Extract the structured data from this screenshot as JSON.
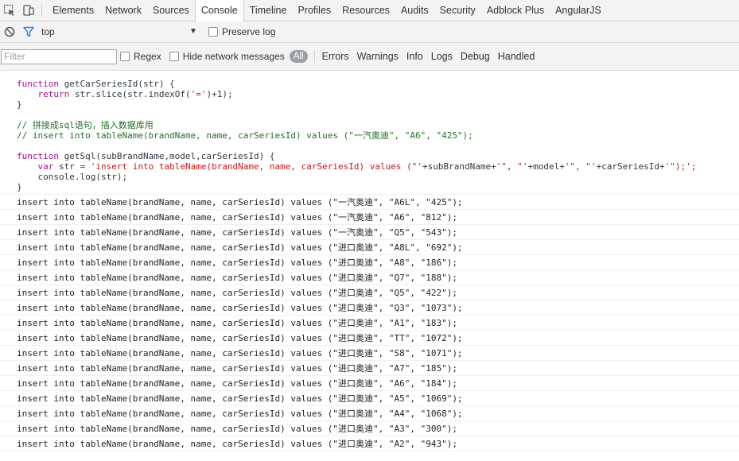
{
  "tabs": [
    {
      "label": "Elements",
      "active": false
    },
    {
      "label": "Network",
      "active": false
    },
    {
      "label": "Sources",
      "active": false
    },
    {
      "label": "Console",
      "active": true
    },
    {
      "label": "Timeline",
      "active": false
    },
    {
      "label": "Profiles",
      "active": false
    },
    {
      "label": "Resources",
      "active": false
    },
    {
      "label": "Audits",
      "active": false
    },
    {
      "label": "Security",
      "active": false
    },
    {
      "label": "Adblock Plus",
      "active": false
    },
    {
      "label": "AngularJS",
      "active": false
    }
  ],
  "context": {
    "value": "top",
    "preserve_log": "Preserve log"
  },
  "filter": {
    "placeholder": "Filter",
    "regex": "Regex",
    "hide_network": "Hide network messages",
    "levels": [
      "All",
      "Errors",
      "Warnings",
      "Info",
      "Logs",
      "Debug",
      "Handled"
    ]
  },
  "code": {
    "l1": "getCarSeriesId(str) {",
    "l2": "str.slice(str.indexOf(",
    "l2s": "'='",
    "l2e": ")+1);",
    "l3": "}",
    "c1": "// 拼接成sql语句，插入数据库用",
    "c2": "// insert into tableName(brandName, name, carSeriesId) values (\"一汽奥迪\", \"A6\", \"425\");",
    "l4": "getSql(subBrandName,model,carSeriesId) {",
    "l5a": "str = ",
    "l5s1": "'insert into tableName(brandName, name, carSeriesId) values (\"'",
    "l5m1": "+subBrandName+",
    "l5s2": "'\", \"'",
    "l5m2": "+model+",
    "l5s3": "'\", \"'",
    "l5m3": "+carSeriesId+",
    "l5s4": "'\");'",
    "l5e": ";",
    "l6": "console.log(str);",
    "l7": "}",
    "kw_function": "function",
    "kw_return": "return",
    "kw_var": "var"
  },
  "logs": [
    "insert into tableName(brandName, name, carSeriesId) values (\"一汽奥迪\", \"A6L\", \"425\");",
    "insert into tableName(brandName, name, carSeriesId) values (\"一汽奥迪\", \"A6\", \"812\");",
    "insert into tableName(brandName, name, carSeriesId) values (\"一汽奥迪\", \"Q5\", \"543\");",
    "insert into tableName(brandName, name, carSeriesId) values (\"进口奥迪\", \"A8L\", \"692\");",
    "insert into tableName(brandName, name, carSeriesId) values (\"进口奥迪\", \"A8\", \"186\");",
    "insert into tableName(brandName, name, carSeriesId) values (\"进口奥迪\", \"Q7\", \"188\");",
    "insert into tableName(brandName, name, carSeriesId) values (\"进口奥迪\", \"Q5\", \"422\");",
    "insert into tableName(brandName, name, carSeriesId) values (\"进口奥迪\", \"Q3\", \"1073\");",
    "insert into tableName(brandName, name, carSeriesId) values (\"进口奥迪\", \"A1\", \"183\");",
    "insert into tableName(brandName, name, carSeriesId) values (\"进口奥迪\", \"TT\", \"1072\");",
    "insert into tableName(brandName, name, carSeriesId) values (\"进口奥迪\", \"S8\", \"1071\");",
    "insert into tableName(brandName, name, carSeriesId) values (\"进口奥迪\", \"A7\", \"185\");",
    "insert into tableName(brandName, name, carSeriesId) values (\"进口奥迪\", \"A6\", \"184\");",
    "insert into tableName(brandName, name, carSeriesId) values (\"进口奥迪\", \"A5\", \"1069\");",
    "insert into tableName(brandName, name, carSeriesId) values (\"进口奥迪\", \"A4\", \"1068\");",
    "insert into tableName(brandName, name, carSeriesId) values (\"进口奥迪\", \"A3\", \"300\");",
    "insert into tableName(brandName, name, carSeriesId) values (\"进口奥迪\", \"A2\", \"943\");"
  ],
  "icons": {
    "inspect": "inspect-element-icon",
    "device": "device-mode-icon",
    "clear": "clear-console-icon",
    "filter": "filter-icon",
    "dropdown": "dropdown-arrow-icon"
  },
  "colors": {
    "keyword": "#aa0d91",
    "string": "#c41a16",
    "comment": "#236e25",
    "level_all_bg": "#9aa0a6"
  }
}
